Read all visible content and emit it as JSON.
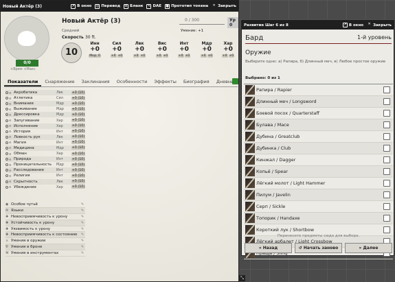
{
  "sheet": {
    "title": "Новый Актёр (3)",
    "buttons": [
      "В окно",
      "Перевод",
      "Бланк",
      "DAE",
      "Прототип токена",
      "Закрыть"
    ],
    "hp": "0/0",
    "hp_sub": "+Врем +Макс",
    "name": "Новый Актёр (3)",
    "xp": "0 / 300",
    "level": "Ур 0",
    "size": "Средний",
    "skill_header": "Умение: +1",
    "speed": "Скорость",
    "speed_val": "30 ft.",
    "prof": "10",
    "abilities": [
      {
        "name": "Инн",
        "mod": "+0",
        "sub": "Мод. 0"
      },
      {
        "name": "Сил",
        "mod": "+0",
        "sub": "+0"
      },
      {
        "name": "Лвк",
        "mod": "+0",
        "sub": "+0"
      },
      {
        "name": "Вис",
        "mod": "+0",
        "sub": "+0"
      },
      {
        "name": "Инт",
        "mod": "+0",
        "sub": "+0"
      },
      {
        "name": "Мдр",
        "mod": "+0",
        "sub": "+0"
      },
      {
        "name": "Хар",
        "mod": "+0",
        "sub": "+0"
      }
    ],
    "ac": "10",
    "tabs": [
      "Показатели",
      "Снаряжение",
      "Заклинания",
      "Особенности",
      "Эффекты",
      "Биография",
      "Дневник"
    ],
    "skills": [
      {
        "name": "Акробатика",
        "abil": "Лвк",
        "val": "+0 (10)"
      },
      {
        "name": "Атлетика",
        "abil": "Сил",
        "val": "+0 (10)"
      },
      {
        "name": "Внимание",
        "abil": "Мдр",
        "val": "+0 (10)"
      },
      {
        "name": "Выживание",
        "abil": "Мдр",
        "val": "+0 (10)"
      },
      {
        "name": "Дрессировка",
        "abil": "Мдр",
        "val": "+0 (10)"
      },
      {
        "name": "Запугивание",
        "abil": "Хар",
        "val": "+0 (10)"
      },
      {
        "name": "Исполнение",
        "abil": "Хар",
        "val": "+0 (10)"
      },
      {
        "name": "История",
        "abil": "Инт",
        "val": "+0 (10)"
      },
      {
        "name": "Ловкость рук",
        "abil": "Лвк",
        "val": "+0 (10)"
      },
      {
        "name": "Магия",
        "abil": "Инт",
        "val": "+0 (10)"
      },
      {
        "name": "Медицина",
        "abil": "Мдр",
        "val": "+0 (10)"
      },
      {
        "name": "Обман",
        "abil": "Хар",
        "val": "+0 (10)"
      },
      {
        "name": "Природа",
        "abil": "Инт",
        "val": "+0 (10)"
      },
      {
        "name": "Проницательность",
        "abil": "Мдр",
        "val": "+0 (10)"
      },
      {
        "name": "Расследование",
        "abil": "Инт",
        "val": "+0 (10)"
      },
      {
        "name": "Религия",
        "abil": "Инт",
        "val": "+0 (10)"
      },
      {
        "name": "Скрытность",
        "abil": "Лвк",
        "val": "+0 (10)"
      },
      {
        "name": "Убеждение",
        "abil": "Хар",
        "val": "+0 (10)"
      }
    ],
    "profs": [
      "Особое чутьё",
      "Языки",
      "Невосприимчивость к урону",
      "Устойчивость к урону",
      "Уязвимость к урону",
      "Невосприимчивость к состоянию",
      "Умения в оружии",
      "Умения в броне",
      "Умения в инструментах"
    ]
  },
  "levelup": {
    "title": "Развитие Шаг 6 из 8",
    "buttons": [
      "В окно",
      "Закрыть"
    ],
    "class": "Бард",
    "class_level": "1-й уровень",
    "section": "Оружие",
    "instruction": "Выберите одно: а) Рапира, б) Длинный меч, в) Любое простое оружие",
    "chosen": "Выбрано: 0 из 1",
    "weapons": [
      "Рапира / Rapier",
      "Длинный меч / Longsword",
      "Боевой посох / Quarterstaff",
      "Булава / Mace",
      "Дубина / Greatclub",
      "Дубинка / Club",
      "Кинжал / Dagger",
      "Копьё / Spear",
      "Лёгкий молот / Light Hammer",
      "Пилум / Javelin",
      "Серп / Sickle",
      "Топорик / Handaxe",
      "Короткий лук / Shortbow",
      "Лёгкий арбалет / Light Crossbow",
      "Праща / Sling"
    ],
    "note": "Перенесите предметы сюда для выбора.",
    "back": "Назад",
    "restart": "Начать заново",
    "next": "Далее"
  }
}
